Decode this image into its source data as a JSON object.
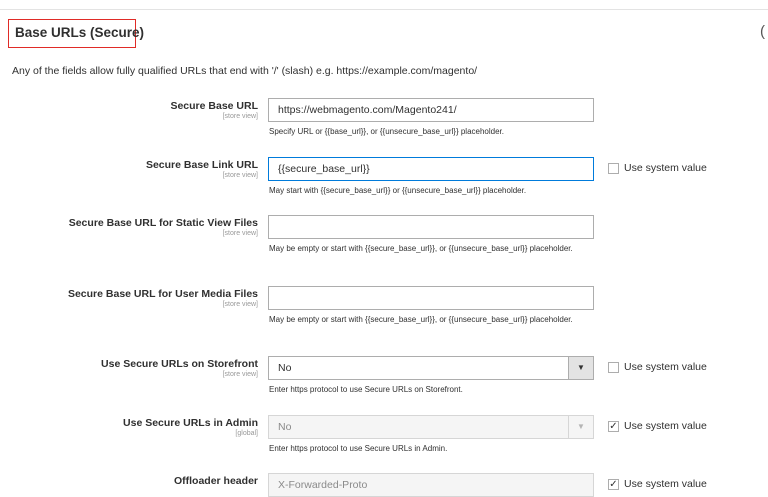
{
  "section": {
    "title": "Base URLs (Secure)",
    "toggle_icon": "(",
    "intro": "Any of the fields allow fully qualified URLs that end with '/' (slash) e.g. https://example.com/magento/"
  },
  "fields": [
    {
      "label": "Secure Base URL",
      "scope": "[store view]",
      "value": "https://webmagento.com/Magento241/",
      "note": "Specify URL or {{base_url}}, or {{unsecure_base_url}} placeholder."
    },
    {
      "label": "Secure Base Link URL",
      "scope": "[store view]",
      "value": "{{secure_base_url}}",
      "note": "May start with {{secure_base_url}} or {{unsecure_base_url}} placeholder.",
      "use_system_value": "Use system value",
      "use_system_checked": false
    },
    {
      "label": "Secure Base URL for Static View Files",
      "scope": "[store view]",
      "value": "",
      "note": "May be empty or start with {{secure_base_url}}, or {{unsecure_base_url}} placeholder."
    },
    {
      "label": "Secure Base URL for User Media Files",
      "scope": "[store view]",
      "value": "",
      "note": "May be empty or start with {{secure_base_url}}, or {{unsecure_base_url}} placeholder."
    },
    {
      "label": "Use Secure URLs on Storefront",
      "scope": "[store view]",
      "value": "No",
      "note": "Enter https protocol to use Secure URLs on Storefront.",
      "use_system_value": "Use system value",
      "use_system_checked": false,
      "checkmark": ""
    },
    {
      "label": "Use Secure URLs in Admin",
      "scope": "[global]",
      "value": "No",
      "note": "Enter https protocol to use Secure URLs in Admin.",
      "use_system_value": "Use system value",
      "use_system_checked": true,
      "checkmark": "✓"
    },
    {
      "label": "Offloader header",
      "value": "X-Forwarded-Proto",
      "use_system_value": "Use system value",
      "checkmark": "✓"
    }
  ],
  "icons": {
    "select_arrow": "▼"
  }
}
